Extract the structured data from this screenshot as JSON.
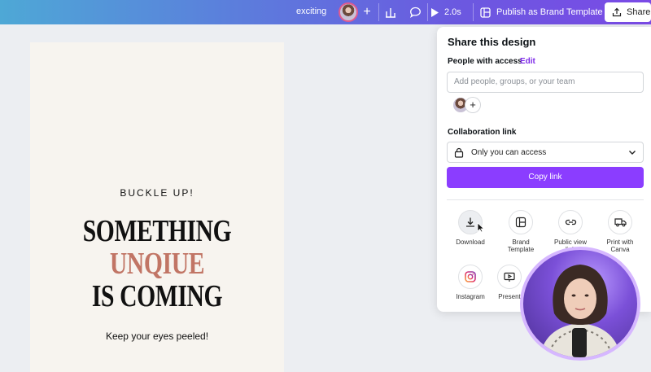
{
  "topbar": {
    "title": "exciting",
    "plus": "+",
    "duration": "2.0s",
    "publish_label": "Publish as Brand Template",
    "share_label": "Share"
  },
  "canvas": {
    "kicker": "BUCKLE UP!",
    "headline_line1": "SOMETHING",
    "headline_line2": "UNQIUE",
    "headline_line3": "IS COMING",
    "subline": "Keep your eyes peeled!"
  },
  "share_panel": {
    "title": "Share this design",
    "people_label": "People with access",
    "edit_label": "Edit",
    "people_placeholder": "Add people, groups, or your team",
    "add_plus": "+",
    "collab_label": "Collaboration link",
    "access_option": "Only you can access",
    "copy_link_label": "Copy link",
    "options": [
      {
        "label": "Download",
        "icon": "download-icon"
      },
      {
        "label": "Brand Template",
        "icon": "brand-template-icon"
      },
      {
        "label": "Public view link",
        "icon": "link-icon"
      },
      {
        "label": "Print with Canva",
        "icon": "truck-icon"
      },
      {
        "label": "Instagram",
        "icon": "instagram-icon"
      },
      {
        "label": "Present",
        "icon": "present-icon"
      }
    ]
  },
  "colors": {
    "accent": "#8b3dff",
    "edit_link": "#7d2ae8",
    "headline_accent": "#c17565"
  }
}
